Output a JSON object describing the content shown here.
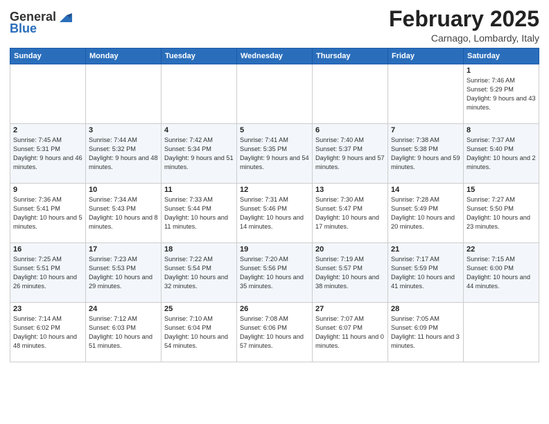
{
  "header": {
    "logo_general": "General",
    "logo_blue": "Blue",
    "month_year": "February 2025",
    "location": "Carnago, Lombardy, Italy"
  },
  "weekdays": [
    "Sunday",
    "Monday",
    "Tuesday",
    "Wednesday",
    "Thursday",
    "Friday",
    "Saturday"
  ],
  "weeks": [
    [
      {
        "day": "",
        "info": ""
      },
      {
        "day": "",
        "info": ""
      },
      {
        "day": "",
        "info": ""
      },
      {
        "day": "",
        "info": ""
      },
      {
        "day": "",
        "info": ""
      },
      {
        "day": "",
        "info": ""
      },
      {
        "day": "1",
        "info": "Sunrise: 7:46 AM\nSunset: 5:29 PM\nDaylight: 9 hours and 43 minutes."
      }
    ],
    [
      {
        "day": "2",
        "info": "Sunrise: 7:45 AM\nSunset: 5:31 PM\nDaylight: 9 hours and 46 minutes."
      },
      {
        "day": "3",
        "info": "Sunrise: 7:44 AM\nSunset: 5:32 PM\nDaylight: 9 hours and 48 minutes."
      },
      {
        "day": "4",
        "info": "Sunrise: 7:42 AM\nSunset: 5:34 PM\nDaylight: 9 hours and 51 minutes."
      },
      {
        "day": "5",
        "info": "Sunrise: 7:41 AM\nSunset: 5:35 PM\nDaylight: 9 hours and 54 minutes."
      },
      {
        "day": "6",
        "info": "Sunrise: 7:40 AM\nSunset: 5:37 PM\nDaylight: 9 hours and 57 minutes."
      },
      {
        "day": "7",
        "info": "Sunrise: 7:38 AM\nSunset: 5:38 PM\nDaylight: 9 hours and 59 minutes."
      },
      {
        "day": "8",
        "info": "Sunrise: 7:37 AM\nSunset: 5:40 PM\nDaylight: 10 hours and 2 minutes."
      }
    ],
    [
      {
        "day": "9",
        "info": "Sunrise: 7:36 AM\nSunset: 5:41 PM\nDaylight: 10 hours and 5 minutes."
      },
      {
        "day": "10",
        "info": "Sunrise: 7:34 AM\nSunset: 5:43 PM\nDaylight: 10 hours and 8 minutes."
      },
      {
        "day": "11",
        "info": "Sunrise: 7:33 AM\nSunset: 5:44 PM\nDaylight: 10 hours and 11 minutes."
      },
      {
        "day": "12",
        "info": "Sunrise: 7:31 AM\nSunset: 5:46 PM\nDaylight: 10 hours and 14 minutes."
      },
      {
        "day": "13",
        "info": "Sunrise: 7:30 AM\nSunset: 5:47 PM\nDaylight: 10 hours and 17 minutes."
      },
      {
        "day": "14",
        "info": "Sunrise: 7:28 AM\nSunset: 5:49 PM\nDaylight: 10 hours and 20 minutes."
      },
      {
        "day": "15",
        "info": "Sunrise: 7:27 AM\nSunset: 5:50 PM\nDaylight: 10 hours and 23 minutes."
      }
    ],
    [
      {
        "day": "16",
        "info": "Sunrise: 7:25 AM\nSunset: 5:51 PM\nDaylight: 10 hours and 26 minutes."
      },
      {
        "day": "17",
        "info": "Sunrise: 7:23 AM\nSunset: 5:53 PM\nDaylight: 10 hours and 29 minutes."
      },
      {
        "day": "18",
        "info": "Sunrise: 7:22 AM\nSunset: 5:54 PM\nDaylight: 10 hours and 32 minutes."
      },
      {
        "day": "19",
        "info": "Sunrise: 7:20 AM\nSunset: 5:56 PM\nDaylight: 10 hours and 35 minutes."
      },
      {
        "day": "20",
        "info": "Sunrise: 7:19 AM\nSunset: 5:57 PM\nDaylight: 10 hours and 38 minutes."
      },
      {
        "day": "21",
        "info": "Sunrise: 7:17 AM\nSunset: 5:59 PM\nDaylight: 10 hours and 41 minutes."
      },
      {
        "day": "22",
        "info": "Sunrise: 7:15 AM\nSunset: 6:00 PM\nDaylight: 10 hours and 44 minutes."
      }
    ],
    [
      {
        "day": "23",
        "info": "Sunrise: 7:14 AM\nSunset: 6:02 PM\nDaylight: 10 hours and 48 minutes."
      },
      {
        "day": "24",
        "info": "Sunrise: 7:12 AM\nSunset: 6:03 PM\nDaylight: 10 hours and 51 minutes."
      },
      {
        "day": "25",
        "info": "Sunrise: 7:10 AM\nSunset: 6:04 PM\nDaylight: 10 hours and 54 minutes."
      },
      {
        "day": "26",
        "info": "Sunrise: 7:08 AM\nSunset: 6:06 PM\nDaylight: 10 hours and 57 minutes."
      },
      {
        "day": "27",
        "info": "Sunrise: 7:07 AM\nSunset: 6:07 PM\nDaylight: 11 hours and 0 minutes."
      },
      {
        "day": "28",
        "info": "Sunrise: 7:05 AM\nSunset: 6:09 PM\nDaylight: 11 hours and 3 minutes."
      },
      {
        "day": "",
        "info": ""
      }
    ]
  ]
}
